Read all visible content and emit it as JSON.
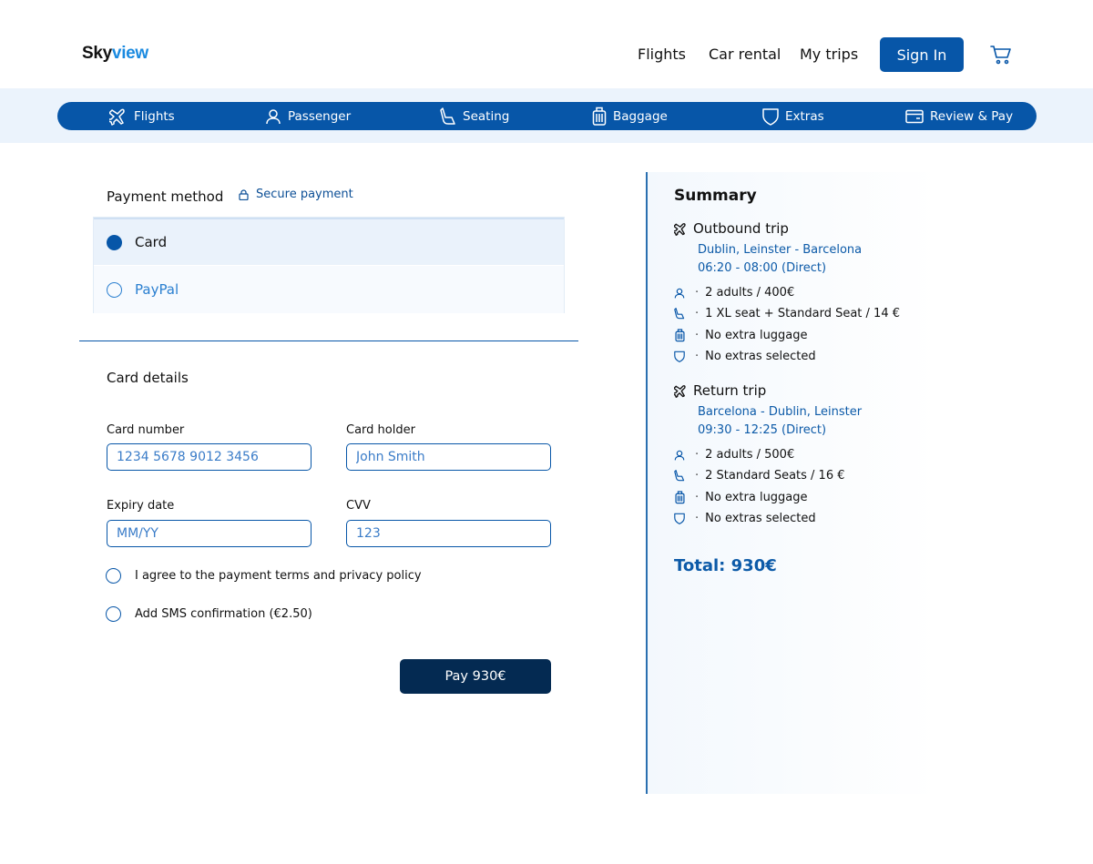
{
  "header": {
    "logo_a": "Sky",
    "logo_b": "view",
    "nav": [
      "Flights",
      "Car rental",
      "My trips"
    ],
    "signin_label": "Sign In",
    "cart_icon": "cart-icon"
  },
  "steps": [
    {
      "label": "Flights",
      "icon": "plane-icon"
    },
    {
      "label": "Passenger",
      "icon": "person-icon"
    },
    {
      "label": "Seating",
      "icon": "seat-icon"
    },
    {
      "label": "Baggage",
      "icon": "luggage-icon"
    },
    {
      "label": "Extras",
      "icon": "shield-icon"
    },
    {
      "label": "Review & Pay",
      "icon": "wallet-icon"
    }
  ],
  "payment": {
    "title": "Payment method",
    "secure_label": "Secure payment",
    "methods": [
      {
        "label": "Card",
        "selected": true
      },
      {
        "label": "PayPal",
        "selected": false
      }
    ]
  },
  "card_details": {
    "title": "Card details",
    "number_label": "Card number",
    "number_placeholder": "1234 5678 9012 3456",
    "holder_label": "Card holder",
    "holder_placeholder": "John Smith",
    "expiry_label": "Expiry date",
    "expiry_placeholder": "MM/YY",
    "cvv_label": "CVV",
    "cvv_placeholder": "123"
  },
  "options": {
    "terms": "I agree to the payment terms and privacy policy",
    "sms": "Add SMS confirmation (€2.50)"
  },
  "pay_label": "Pay 930€",
  "summary": {
    "title": "Summary",
    "outbound": {
      "title": "Outbound trip",
      "route": "Dublin, Leinster - Barcelona",
      "time": "06:20 - 08:00 (Direct)",
      "rows": [
        "2 adults / 400€",
        "1 XL seat + Standard Seat / 14 €",
        "No extra luggage",
        "No extras selected"
      ]
    },
    "return": {
      "title": "Return trip",
      "route": "Barcelona - Dublin, Leinster",
      "time": "09:30 - 12:25 (Direct)",
      "rows": [
        "2 adults / 500€",
        "2 Standard Seats / 16 €",
        "No extra luggage",
        "No extras selected"
      ]
    },
    "total": "Total: 930€"
  },
  "colors": {
    "brand": "#0756a8",
    "brand_dark": "#042a52",
    "accent_text": "#0c5aa8",
    "band": "#ebf3fc"
  }
}
